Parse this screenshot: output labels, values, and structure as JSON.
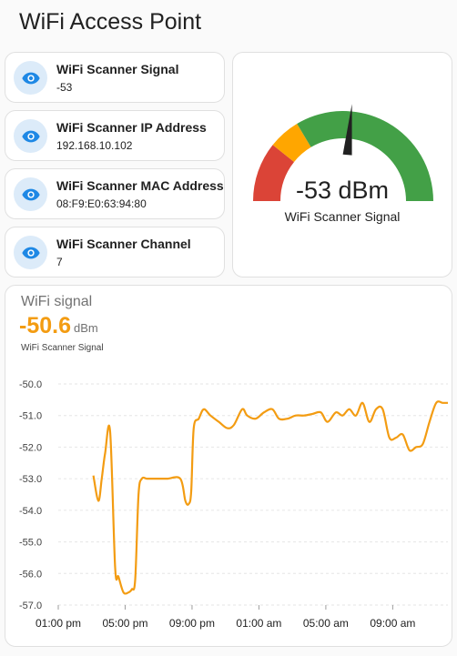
{
  "page": {
    "title": "WiFi Access Point"
  },
  "entities": [
    {
      "name": "WiFi Scanner Signal",
      "state": "-53",
      "icon": "eye-icon"
    },
    {
      "name": "WiFi Scanner IP Address",
      "state": "192.168.10.102",
      "icon": "eye-icon"
    },
    {
      "name": "WiFi Scanner MAC Address",
      "state": "08:F9:E0:63:94:80",
      "icon": "eye-icon"
    },
    {
      "name": "WiFi Scanner Channel",
      "state": "7",
      "icon": "eye-icon"
    }
  ],
  "gauge": {
    "value": -53,
    "value_text": "-53 dBm",
    "label": "WiFi Scanner Signal",
    "min": -90,
    "max": -20,
    "segments": [
      {
        "from": -90,
        "to": -75,
        "color": "#db4437"
      },
      {
        "from": -75,
        "to": -67,
        "color": "#ffa600"
      },
      {
        "from": -67,
        "to": -20,
        "color": "#43a047"
      }
    ]
  },
  "graph": {
    "title": "WiFi signal",
    "current_value": "-50.6",
    "unit": "dBm",
    "entity_label": "WiFi Scanner Signal",
    "accent_color": "#f39c12"
  },
  "chart_data": {
    "type": "line",
    "title": "",
    "xlabel": "",
    "ylabel": "",
    "ylim": [
      -57.0,
      -50.0
    ],
    "yticks": [
      "-50.0",
      "-51.0",
      "-52.0",
      "-53.0",
      "-54.0",
      "-55.0",
      "-56.0",
      "-57.0"
    ],
    "xlim": [
      0,
      23.3
    ],
    "xticks": [
      {
        "pos": 0,
        "label": "01:00 pm"
      },
      {
        "pos": 4,
        "label": "05:00 pm"
      },
      {
        "pos": 8,
        "label": "09:00 pm"
      },
      {
        "pos": 12,
        "label": "01:00 am"
      },
      {
        "pos": 16,
        "label": "05:00 am"
      },
      {
        "pos": 20,
        "label": "09:00 am"
      }
    ],
    "grid": true,
    "series": [
      {
        "name": "WiFi Scanner Signal",
        "color": "#f39c12",
        "x": [
          2.1,
          2.4,
          2.6,
          2.8,
          3.1,
          3.4,
          3.6,
          3.9,
          4.2,
          4.4,
          4.6,
          4.8,
          5.0,
          5.3,
          5.8,
          6.5,
          7.3,
          7.6,
          7.8,
          7.95,
          8.1,
          8.4,
          8.7,
          9.1,
          9.6,
          10.1,
          10.5,
          11.0,
          11.3,
          11.8,
          12.3,
          12.8,
          13.2,
          13.7,
          14.2,
          14.7,
          15.2,
          15.7,
          16.1,
          16.6,
          17.0,
          17.4,
          17.8,
          18.2,
          18.6,
          19.0,
          19.4,
          19.8,
          20.2,
          20.6,
          21.0,
          21.4,
          21.8,
          22.2,
          22.6,
          23.0,
          23.3
        ],
        "values": [
          -52.9,
          -53.7,
          -53.0,
          -52.2,
          -51.5,
          -55.8,
          -56.1,
          -56.6,
          -56.6,
          -56.5,
          -56.2,
          -53.5,
          -53.0,
          -53.0,
          -53.0,
          -53.0,
          -53.0,
          -53.7,
          -53.8,
          -53.4,
          -51.4,
          -51.1,
          -50.8,
          -51.0,
          -51.2,
          -51.4,
          -51.3,
          -50.8,
          -51.0,
          -51.1,
          -50.9,
          -50.8,
          -51.1,
          -51.1,
          -51.0,
          -51.0,
          -50.95,
          -50.9,
          -51.2,
          -50.9,
          -51.0,
          -50.8,
          -51.0,
          -50.6,
          -51.2,
          -50.8,
          -50.8,
          -51.7,
          -51.7,
          -51.6,
          -52.1,
          -52.0,
          -51.9,
          -51.2,
          -50.6,
          -50.6,
          -50.6
        ]
      }
    ]
  }
}
